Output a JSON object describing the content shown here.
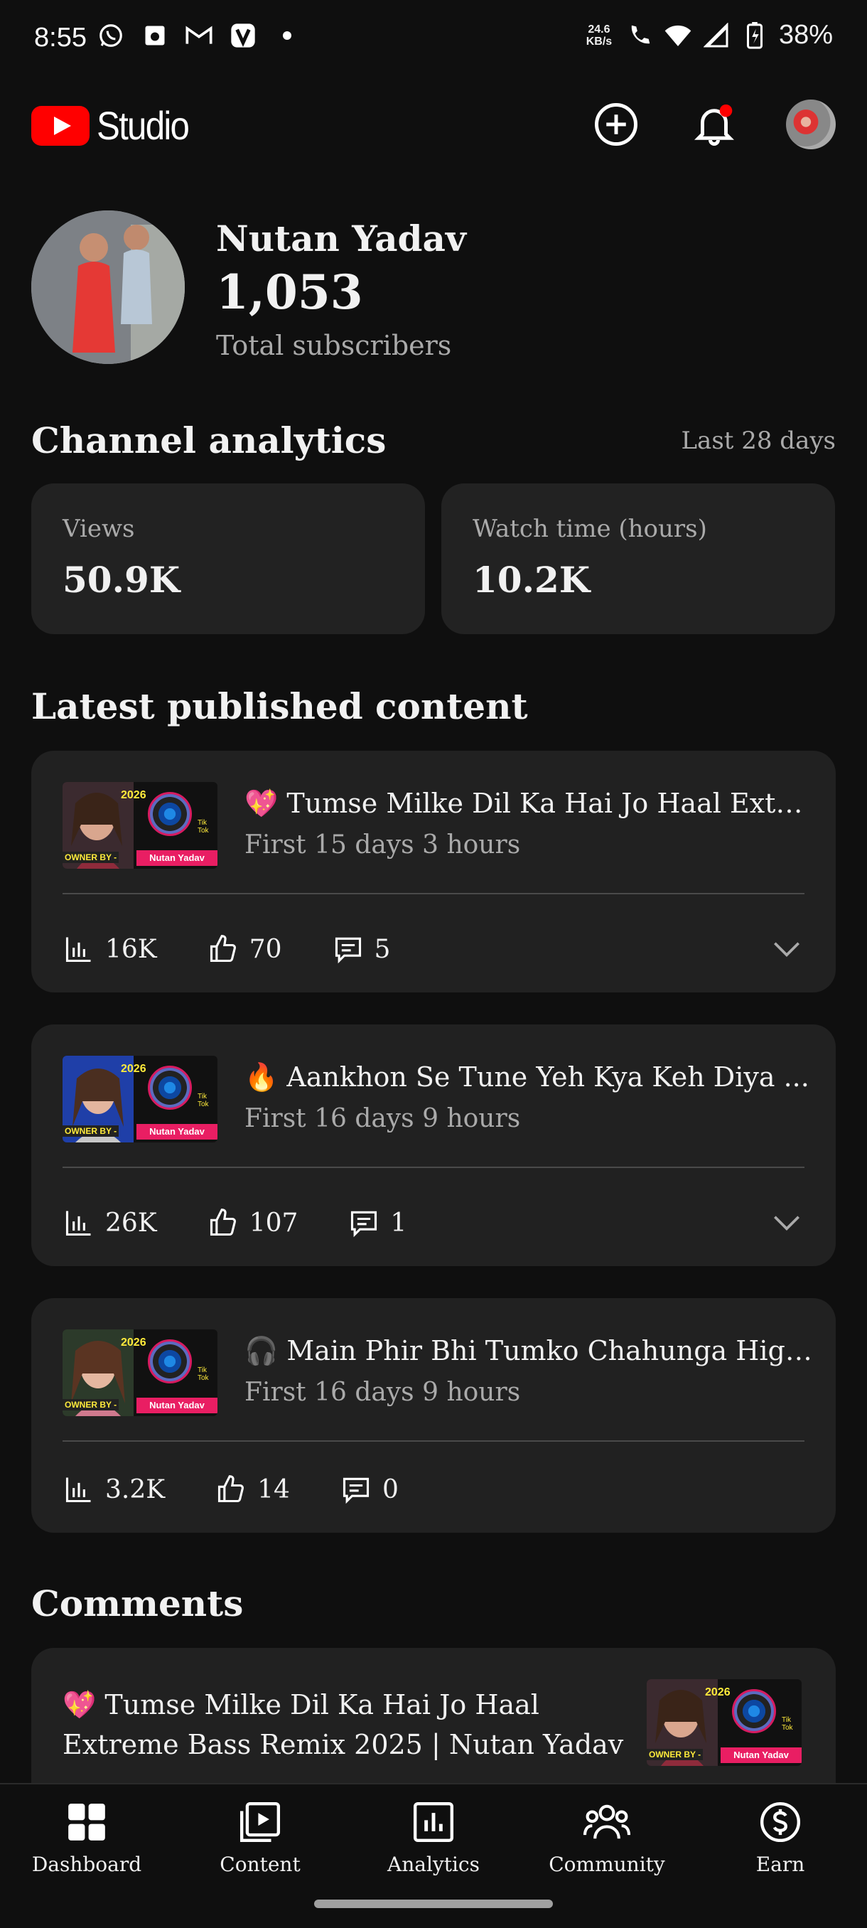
{
  "status_bar": {
    "time": "8:55",
    "speed": "24.6 KB/s",
    "battery": "38%",
    "icons_left": [
      "whatsapp-icon",
      "media-icon",
      "gmail-icon",
      "vpn-icon",
      "dot-icon"
    ],
    "icons_right": [
      "wifi-call-icon",
      "wifi-icon",
      "signal-icon",
      "battery-icon"
    ]
  },
  "header": {
    "logo_text": "Studio",
    "create_icon": "plus-circle-icon",
    "notifications_icon": "bell-icon",
    "notification_badge_color": "#ff0000"
  },
  "channel": {
    "name": "Nutan Yadav",
    "subscribers": "1,053",
    "subscribers_label": "Total subscribers"
  },
  "analytics": {
    "title": "Channel analytics",
    "range": "Last 28 days",
    "cards": [
      {
        "label": "Views",
        "value": "50.9K"
      },
      {
        "label": "Watch time (hours)",
        "value": "10.2K"
      }
    ]
  },
  "latest": {
    "title": "Latest published content",
    "thumb_text": {
      "year": "2026",
      "tiktok": "Tik Tok",
      "owner": "OWNER BY -",
      "brand": "Nutan Yadav"
    },
    "videos": [
      {
        "title": "💖 Tumse Milke Dil Ka Hai Jo Haal Extre...",
        "period": "First 15 days 3 hours",
        "views": "16K",
        "likes": "70",
        "comments": "5",
        "expand": true
      },
      {
        "title": "🔥 Aankhon Se Tune Yeh Kya Keh Diya ...",
        "period": "First 16 days 9 hours",
        "views": "26K",
        "likes": "107",
        "comments": "1",
        "expand": true
      },
      {
        "title": "🎧 Main Phir Bhi Tumko Chahunga High...",
        "period": "First 16 days 9 hours",
        "views": "3.2K",
        "likes": "14",
        "comments": "0",
        "expand": false
      }
    ]
  },
  "comments": {
    "title": "Comments",
    "preview_video_title": "💖 Tumse Milke Dil Ka Hai Jo Haal Extreme Bass Remix 2025 | Nutan Yadav"
  },
  "bottom_nav": [
    {
      "label": "Dashboard",
      "icon": "dashboard-icon",
      "active": true
    },
    {
      "label": "Content",
      "icon": "content-icon",
      "active": false
    },
    {
      "label": "Analytics",
      "icon": "analytics-icon",
      "active": false
    },
    {
      "label": "Community",
      "icon": "community-icon",
      "active": false
    },
    {
      "label": "Earn",
      "icon": "earn-icon",
      "active": false
    }
  ],
  "colors": {
    "background": "#0f0f0f",
    "card": "#222222",
    "brand_red": "#ff0000",
    "muted_text": "#aaaaaa"
  }
}
